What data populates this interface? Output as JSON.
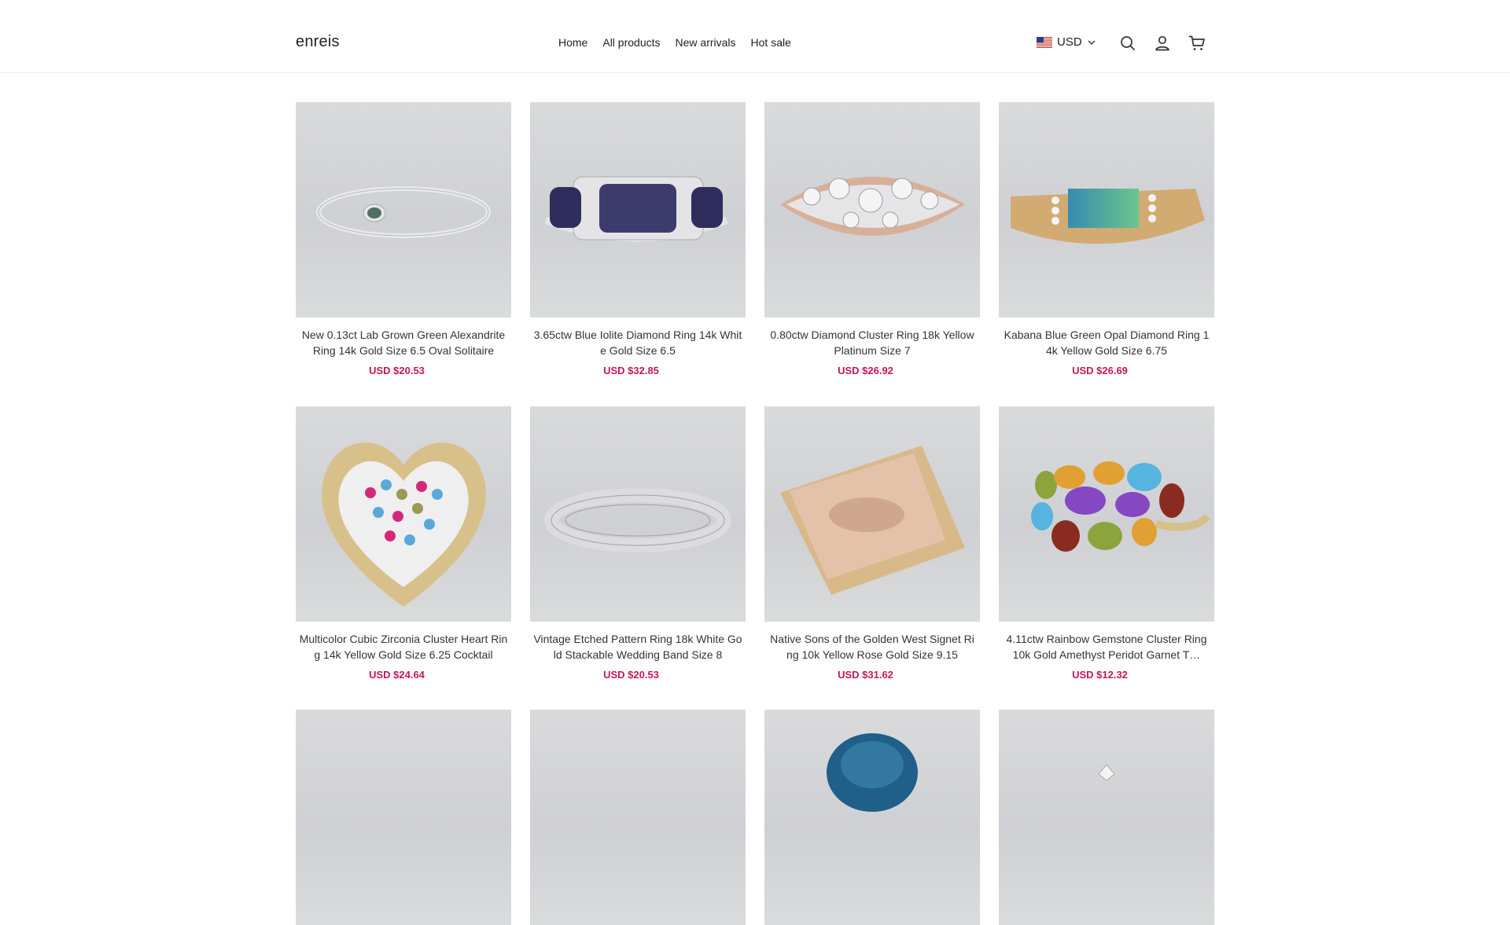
{
  "brand": {
    "name": "enreis"
  },
  "nav": {
    "items": [
      "Home",
      "All products",
      "New arrivals",
      "Hot sale"
    ]
  },
  "currency": {
    "code": "USD",
    "flag_icon": "us-flag-icon"
  },
  "icons": {
    "search": "search-icon",
    "account": "user-icon",
    "cart": "cart-icon"
  },
  "colors": {
    "price": "#c2185b",
    "background": "#ffffff"
  },
  "products": [
    {
      "title": "New 0.13ct Lab Grown Green Alexandrite Ring 14k Gold Size 6.5 Oval Solitaire",
      "price": "USD $20.53"
    },
    {
      "title": "3.65ctw Blue Iolite Diamond Ring 14k White Gold Size 6.5",
      "price": "USD $32.85"
    },
    {
      "title": "0.80ctw Diamond Cluster Ring 18k Yellow Platinum Size 7",
      "price": "USD $26.92"
    },
    {
      "title": "Kabana Blue Green Opal Diamond Ring 14k Yellow Gold Size 6.75",
      "price": "USD $26.69"
    },
    {
      "title": "Multicolor Cubic Zirconia Cluster Heart Ring 14k Yellow Gold Size 6.25 Cocktail",
      "price": "USD $24.64"
    },
    {
      "title": "Vintage Etched Pattern Ring 18k White Gold Stackable Wedding Band Size 8",
      "price": "USD $20.53"
    },
    {
      "title": "Native Sons of the Golden West Signet Ring 10k Yellow Rose Gold Size 9.15",
      "price": "USD $31.62"
    },
    {
      "title": "4.11ctw Rainbow Gemstone Cluster Ring 10k Gold Amethyst Peridot Garnet T…",
      "price": "USD $12.32"
    }
  ]
}
